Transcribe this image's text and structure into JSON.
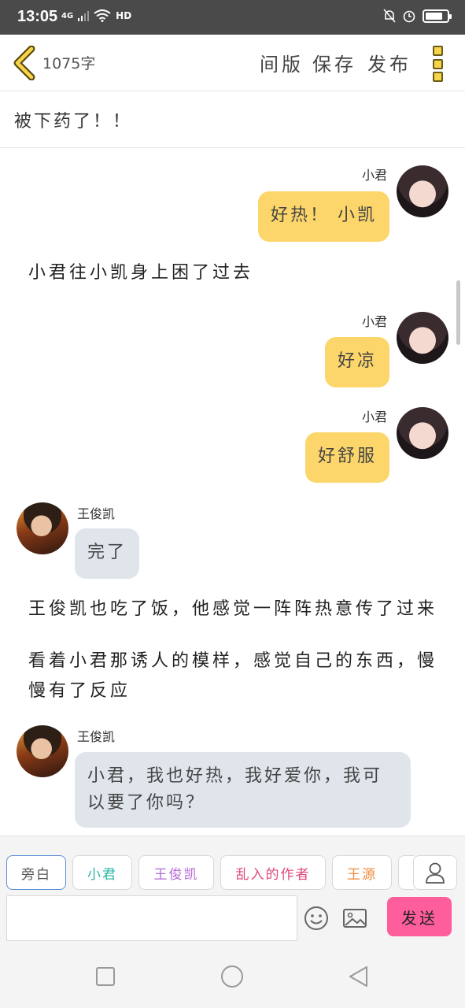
{
  "status": {
    "time": "13:05",
    "network": "4G",
    "hd": "HD",
    "battery_level": 0.8
  },
  "header": {
    "word_count": "1075字",
    "layout_label": "间版",
    "save_label": "保存",
    "publish_label": "发布"
  },
  "story": {
    "title": "被下药了！！"
  },
  "messages": [
    {
      "speaker": "小君",
      "text": "好热！ 小凯",
      "side": "right"
    },
    {
      "narration": "小君往小凯身上困了过去"
    },
    {
      "speaker": "小君",
      "text": "好凉",
      "side": "right"
    },
    {
      "speaker": "小君",
      "text": "好舒服",
      "side": "right"
    },
    {
      "speaker": "王俊凯",
      "text": "完了",
      "side": "left"
    },
    {
      "narration": "王俊凯也吃了饭，他感觉一阵阵热意传了过来"
    },
    {
      "narration": "看着小君那诱人的模样，感觉自己的东西，慢慢有了反应"
    },
    {
      "speaker": "王俊凯",
      "text": "小君，我也好热，我好爱你，我可以要了你吗？",
      "side": "left"
    }
  ],
  "characters": [
    {
      "label": "旁白",
      "color": "#555555"
    },
    {
      "label": "小君",
      "color": "#2bb3a3"
    },
    {
      "label": "王俊凯",
      "color": "#b46ad6"
    },
    {
      "label": "乱入的作者",
      "color": "#e0487a"
    },
    {
      "label": "王源",
      "color": "#f08a3c"
    }
  ],
  "composer": {
    "input_value": "",
    "send_label": "发送"
  },
  "icons": {
    "back": "chevron-left-icon",
    "more": "more-vertical-icon",
    "profile": "person-icon",
    "emoji": "emoji-icon",
    "image": "image-icon",
    "nav_recent": "square-icon",
    "nav_home": "circle-icon",
    "nav_back": "triangle-back-icon"
  },
  "colors": {
    "right_bubble": "#fcd66a",
    "left_bubble": "#e0e5ec",
    "send_button": "#ff5e9c",
    "accent_yellow": "#f6d54a"
  }
}
